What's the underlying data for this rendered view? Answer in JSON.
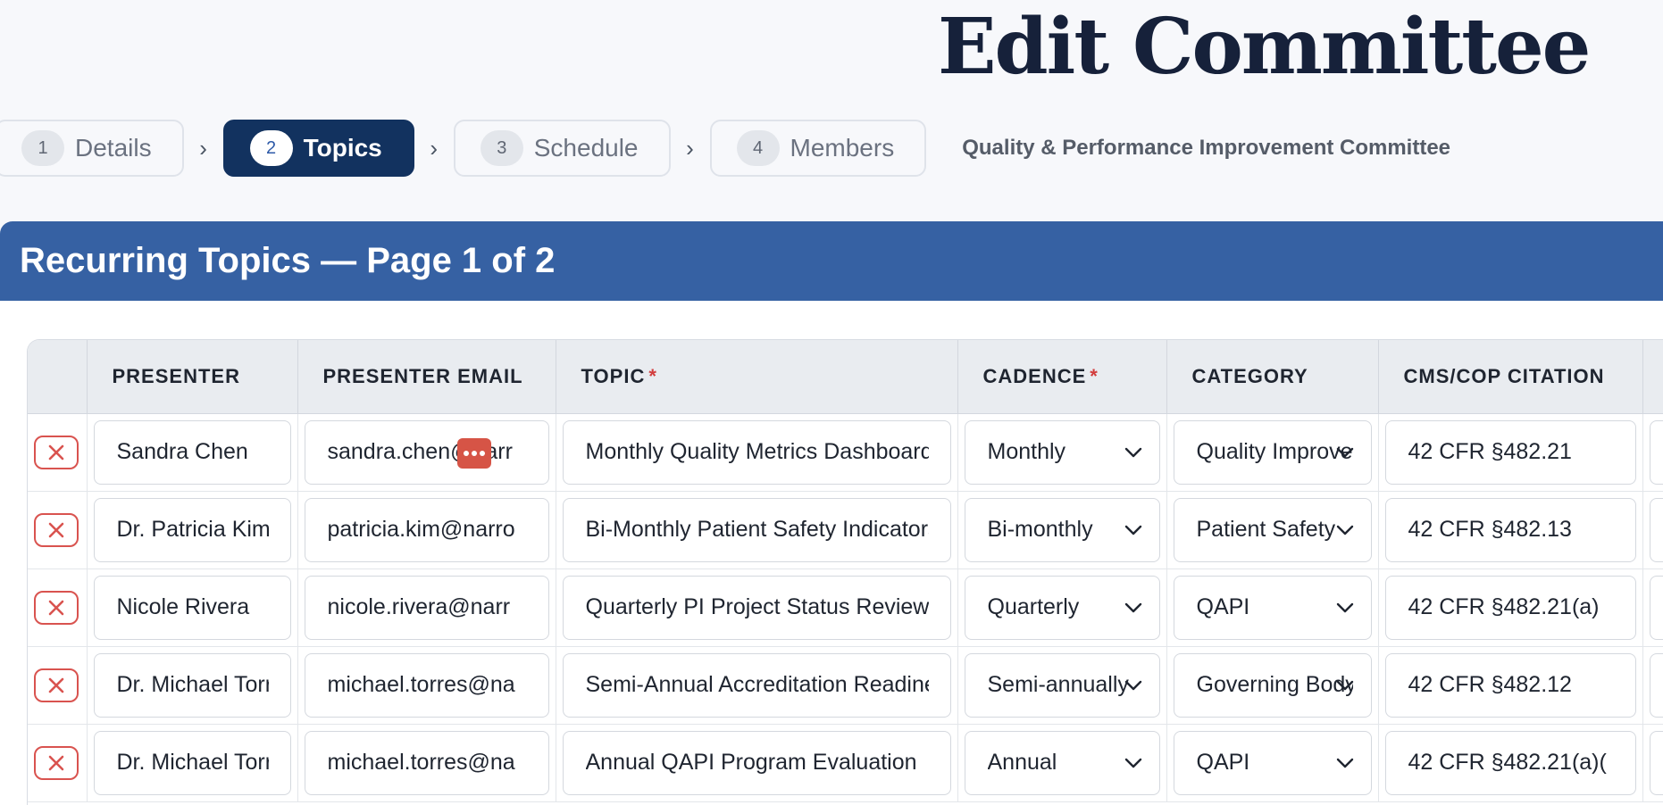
{
  "page": {
    "title": "Edit Committee"
  },
  "stepper": {
    "steps": [
      {
        "num": "1",
        "label": "Details"
      },
      {
        "num": "2",
        "label": "Topics"
      },
      {
        "num": "3",
        "label": "Schedule"
      },
      {
        "num": "4",
        "label": "Members"
      }
    ],
    "separator": "›",
    "committee_name": "Quality & Performance Improvement Committee"
  },
  "panel": {
    "title": "Recurring Topics — Page 1 of 2"
  },
  "table": {
    "columns": {
      "presenter": "PRESENTER",
      "email": "PRESENTER EMAIL",
      "topic": "TOPIC",
      "cadence": "CADENCE",
      "category": "CATEGORY",
      "citation": "CMS/COP CITATION",
      "required_mark": "*"
    },
    "rows": [
      {
        "presenter": "Sandra Chen",
        "email": "sandra.chen@narr",
        "topic": "Monthly Quality Metrics Dashboard",
        "cadence": "Monthly",
        "category": "Quality Improvement",
        "citation": "42 CFR §482.21"
      },
      {
        "presenter": "Dr. Patricia Kim",
        "email": "patricia.kim@narro",
        "topic": "Bi-Monthly Patient Safety Indicators",
        "cadence": "Bi-monthly",
        "category": "Patient Safety",
        "citation": "42 CFR §482.13"
      },
      {
        "presenter": "Nicole Rivera",
        "email": "nicole.rivera@narr",
        "topic": "Quarterly PI Project Status Review",
        "cadence": "Quarterly",
        "category": "QAPI",
        "citation": "42 CFR §482.21(a)"
      },
      {
        "presenter": "Dr. Michael Torres",
        "email": "michael.torres@na",
        "topic": "Semi-Annual Accreditation Readiness",
        "cadence": "Semi-annually",
        "category": "Governing Body",
        "citation": "42 CFR §482.12"
      },
      {
        "presenter": "Dr. Michael Torres",
        "email": "michael.torres@na",
        "topic": "Annual QAPI Program Evaluation",
        "cadence": "Annual",
        "category": "QAPI",
        "citation": "42 CFR §482.21(a)("
      }
    ]
  },
  "colors": {
    "header_blue": "#3661a3",
    "active_step": "#12325f",
    "delete_red": "#d9534f",
    "required_red": "#d23c3c"
  }
}
